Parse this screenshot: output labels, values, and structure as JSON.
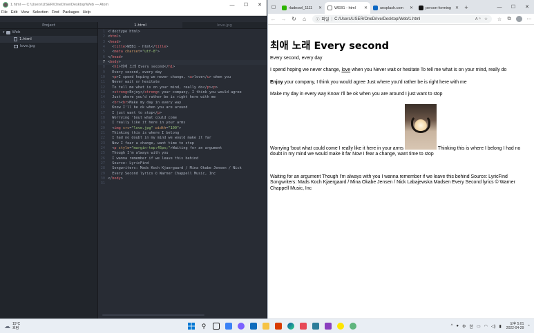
{
  "atom": {
    "title": "1.html — C:\\Users\\USER\\OneDrive\\Desktop\\Web — Atom",
    "menu": [
      "File",
      "Edit",
      "View",
      "Selection",
      "Find",
      "Packages",
      "Help"
    ],
    "tree_header": "Project",
    "tree": {
      "folder": "Web",
      "files": [
        "1.html",
        "love.jpg"
      ]
    },
    "tabs": [
      "1.html",
      "love.jpg"
    ],
    "code": [
      "<!doctype html>",
      "<html>",
      "<head>",
      "  <title>WEB1 - html</title>",
      "  <meta charset=\"utf-8\">",
      "</head>",
      "<body>",
      "  <h1>최애 노래 Every second</h1>",
      "  Every second, every day",
      "  <p>I spend hoping we never change, <u>love</u> when you",
      "  Never wait or hesitate",
      "  To tell me what is on your mind, really do</p><p>",
      "  <strong>Enjoy</strong> your company, I think you would agree",
      "  Just where you'd rather be is right here with me",
      "  <br><br>Make my day in every way",
      "  Know I'll be ok when you are around",
      "  I just want to stop</p>",
      "  Worrying 'bout what could come",
      "  I really like it here in your arms",
      "  <img src=\"love.jpg\" width=\"100\">",
      "  Thinking this is where I belong",
      "  I had no doubt in my mind we would make it far",
      "  Now I fear a change, want time to stop",
      "  <p style=\"margin-top:45px;\">Waiting for an argument",
      "  Though I'm always with you",
      "  I wanna remember if we leave this behind",
      "  Source: LyricFind",
      "  Songwriters: Mads Koch Kjaergaard / Mina Okabe Jensen / Nick",
      "  Every Second lyrics © Warner Chappell Music, Inc",
      "</body>",
      ""
    ]
  },
  "browser": {
    "tabs": [
      {
        "label": "rladnswl_1111",
        "color": "#2db400"
      },
      {
        "label": "WEB1 - html",
        "color": "#ffffff"
      },
      {
        "label": "unsplash.com",
        "color": "#0a66c2"
      },
      {
        "label": "person-forming",
        "color": "#111111"
      }
    ],
    "address": {
      "badge": "파일",
      "url": "C:/Users/USER/OneDrive/Desktop/Web/1.html"
    },
    "page": {
      "h1": "최애 노래 Every second",
      "line1": "Every second, every day",
      "p1_before": "I spend hoping we never change, ",
      "p1_u": "love",
      "p1_after": " when you Never wait or hesitate To tell me what is on your mind, really do",
      "p2_strong": "Enjoy",
      "p2_rest": " your company, I think you would agree Just where you'd rather be is right here with me",
      "p2_line2": "Make my day in every way Know I'll be ok when you are around I just want to stop",
      "img_before": "Worrying 'bout what could come I really like it here in your arms ",
      "img_after": " Thinking this is where I belong I had no doubt in my mind we would make it far Now I fear a change, want time to stop",
      "p3": "Waiting for an argument Though I'm always with you I wanna remember if we leave this behind Source: LyricFind Songwriters: Mads Koch Kjaergaard / Mina Okabe Jensen / Nick Labajewska Madsen Every Second lyrics © Warner Chappell Music, Inc"
    }
  },
  "taskbar": {
    "weather_temp": "15°C",
    "weather_desc": "흐림",
    "lang": "한",
    "time": "오후 5:01",
    "date": "2022-04-29"
  }
}
